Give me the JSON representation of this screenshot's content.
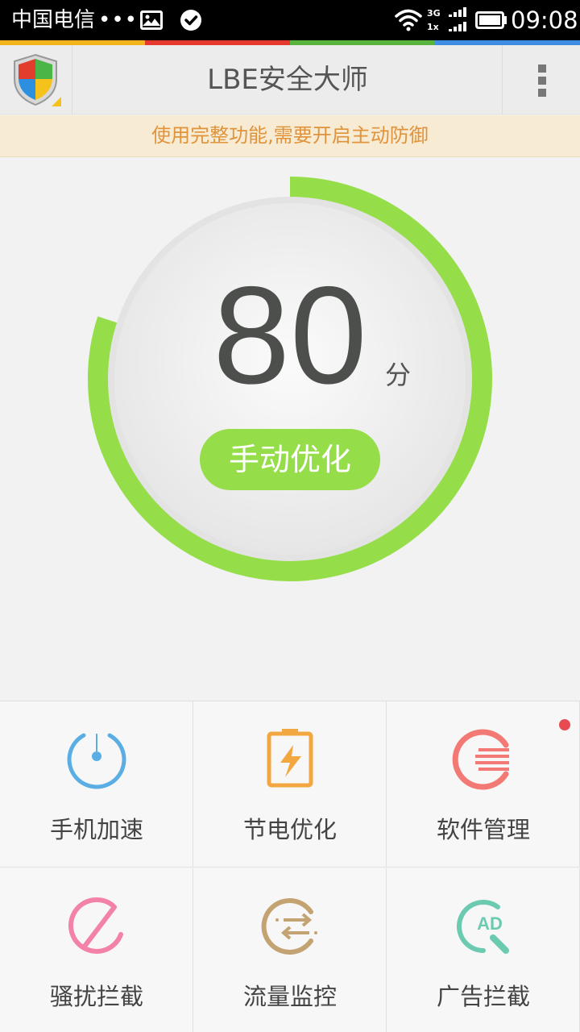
{
  "status_bar": {
    "carrier": "中国电信",
    "overflow_dots": "•••",
    "network_top": "3G",
    "network_bottom": "1x",
    "time": "09:08"
  },
  "color_strip": [
    "#f2b31b",
    "#e5382f",
    "#58b43c",
    "#3d8ee2"
  ],
  "app_bar": {
    "title": "LBE安全大师",
    "logo_icon": "shield-logo-icon",
    "menu_icon": "overflow-menu-icon"
  },
  "notice": {
    "text": "使用完整功能,需要开启主动防御"
  },
  "score": {
    "value": "80",
    "unit": "分",
    "progress": 0.8,
    "ring_color": "#95de4a",
    "button_label": "手动优化"
  },
  "features": [
    {
      "label": "手机加速",
      "icon": "speedometer-icon",
      "color": "#5aaee3",
      "has_badge": false
    },
    {
      "label": "节电优化",
      "icon": "battery-charge-icon",
      "color": "#f3a740",
      "has_badge": false
    },
    {
      "label": "软件管理",
      "icon": "app-manager-icon",
      "color": "#f37a74",
      "has_badge": true
    },
    {
      "label": "骚扰拦截",
      "icon": "block-icon",
      "color": "#f382a8",
      "has_badge": false
    },
    {
      "label": "流量监控",
      "icon": "traffic-monitor-icon",
      "color": "#c4a372",
      "has_badge": false
    },
    {
      "label": "广告拦截",
      "icon": "ad-block-icon",
      "color": "#6ccab0",
      "has_badge": false
    }
  ]
}
